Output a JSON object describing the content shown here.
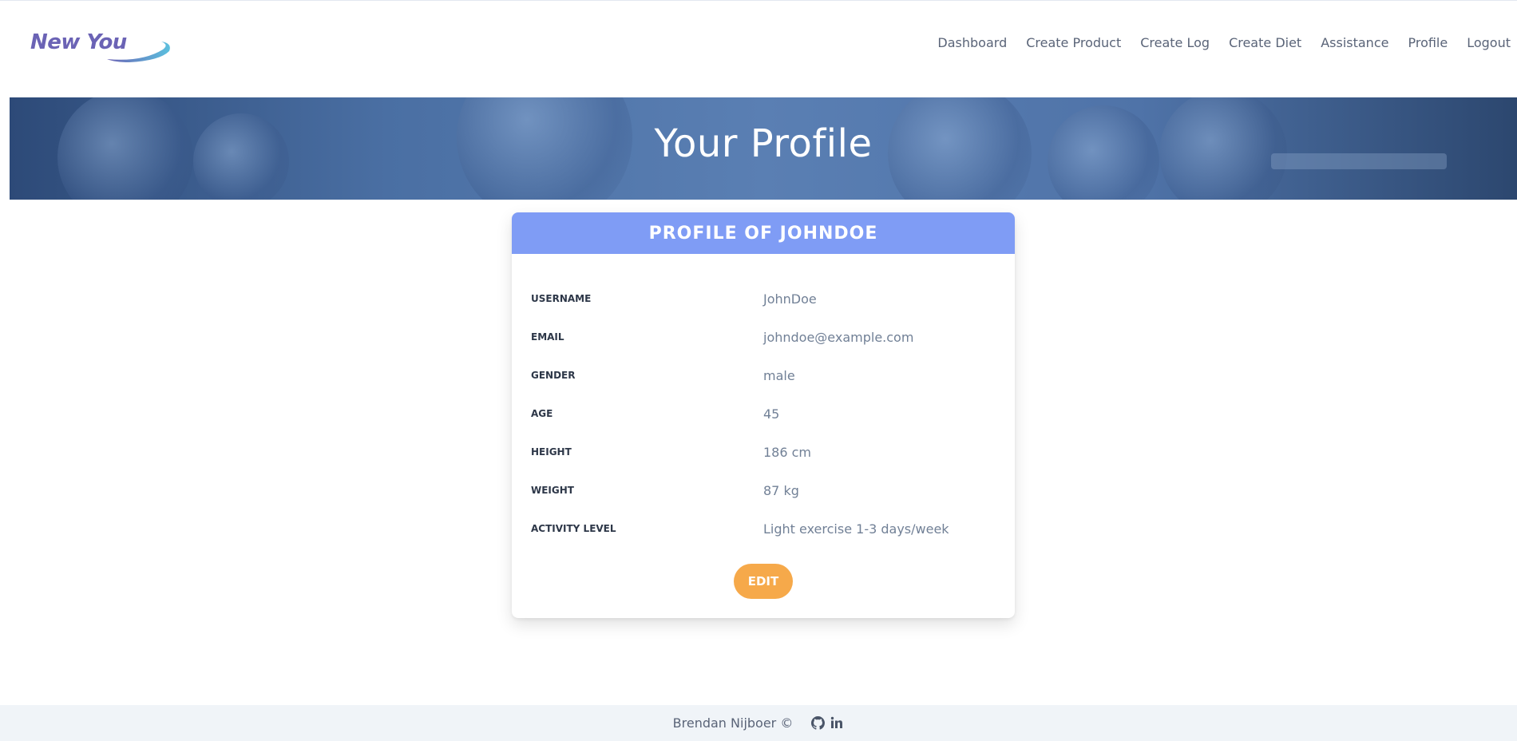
{
  "brand": {
    "name": "New You",
    "text_color": "#6b63b5",
    "swoosh_colors": [
      "#6b63b5",
      "#5bc0de"
    ]
  },
  "nav": {
    "items": [
      {
        "label": "Dashboard"
      },
      {
        "label": "Create Product"
      },
      {
        "label": "Create Log"
      },
      {
        "label": "Create Diet"
      },
      {
        "label": "Assistance"
      },
      {
        "label": "Profile"
      },
      {
        "label": "Logout"
      }
    ]
  },
  "hero": {
    "title": "Your Profile",
    "overlay_color": "#2d4a78"
  },
  "profile": {
    "title": "PROFILE OF JOHNDOE",
    "header_color": "#7f9cf5",
    "fields": [
      {
        "label": "USERNAME",
        "value": "JohnDoe"
      },
      {
        "label": "EMAIL",
        "value": "johndoe@example.com"
      },
      {
        "label": "GENDER",
        "value": "male"
      },
      {
        "label": "AGE",
        "value": "45"
      },
      {
        "label": "HEIGHT",
        "value": "186 cm"
      },
      {
        "label": "WEIGHT",
        "value": "87 kg"
      },
      {
        "label": "ACTIVITY LEVEL",
        "value": "Light exercise 1-3 days/week"
      }
    ],
    "edit_label": "EDIT",
    "edit_color": "#f6a94a"
  },
  "footer": {
    "text": "Brendan Nijboer ©",
    "icons": [
      "github-icon",
      "linkedin-icon"
    ]
  }
}
